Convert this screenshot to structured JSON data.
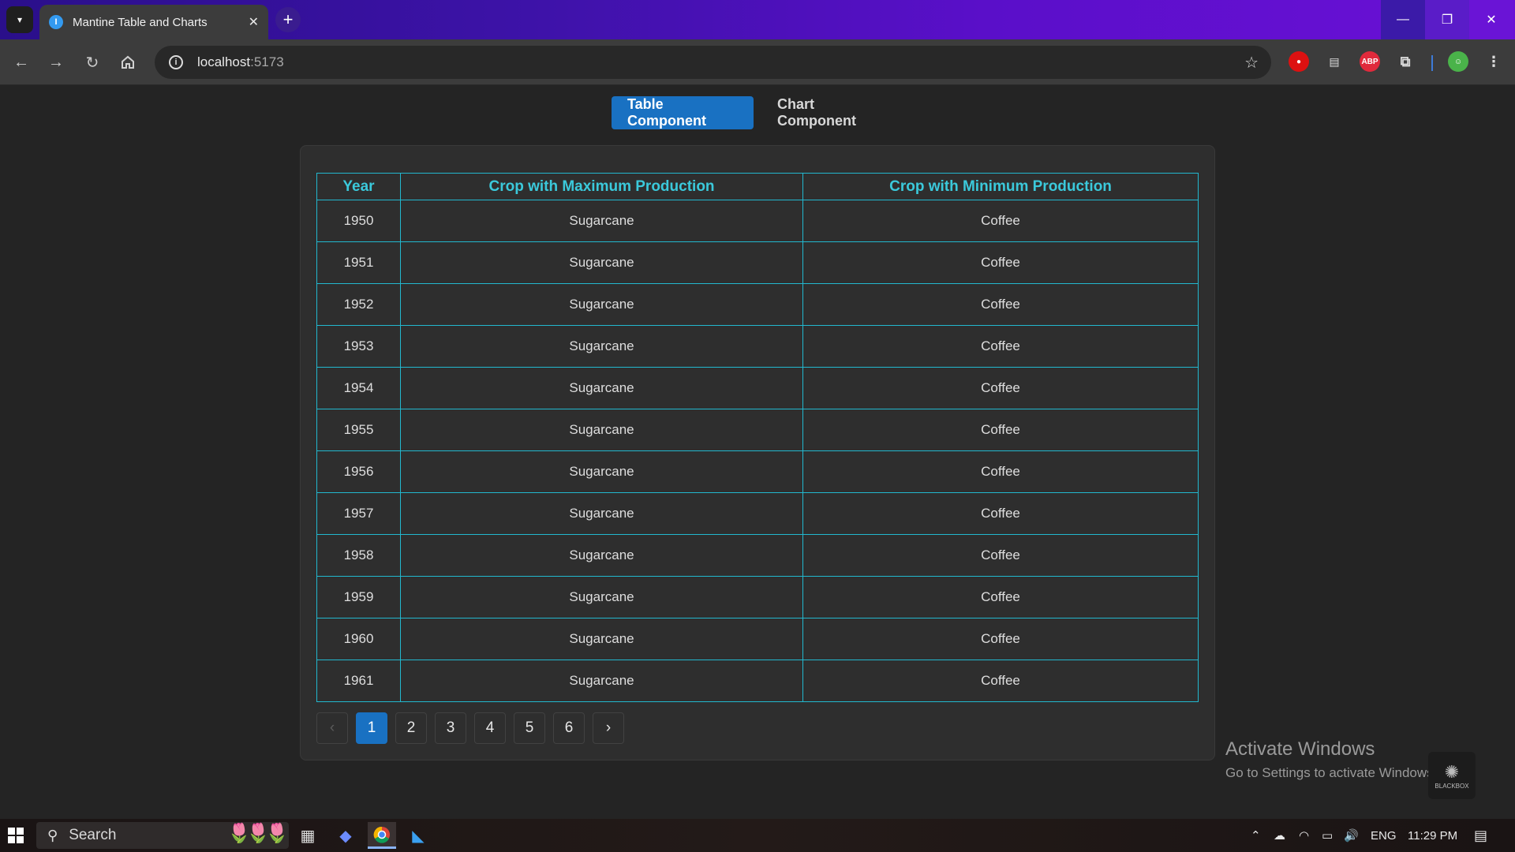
{
  "browser": {
    "tab_title": "Mantine Table and Charts",
    "tab_favicon_letter": "I",
    "url_host": "localhost",
    "url_port": ":5173"
  },
  "nav_tabs": {
    "table_label": "Table Component",
    "chart_label": "Chart Component"
  },
  "table": {
    "headers": [
      "Year",
      "Crop with Maximum Production",
      "Crop with Minimum Production"
    ],
    "rows": [
      [
        "1950",
        "Sugarcane",
        "Coffee"
      ],
      [
        "1951",
        "Sugarcane",
        "Coffee"
      ],
      [
        "1952",
        "Sugarcane",
        "Coffee"
      ],
      [
        "1953",
        "Sugarcane",
        "Coffee"
      ],
      [
        "1954",
        "Sugarcane",
        "Coffee"
      ],
      [
        "1955",
        "Sugarcane",
        "Coffee"
      ],
      [
        "1956",
        "Sugarcane",
        "Coffee"
      ],
      [
        "1957",
        "Sugarcane",
        "Coffee"
      ],
      [
        "1958",
        "Sugarcane",
        "Coffee"
      ],
      [
        "1959",
        "Sugarcane",
        "Coffee"
      ],
      [
        "1960",
        "Sugarcane",
        "Coffee"
      ],
      [
        "1961",
        "Sugarcane",
        "Coffee"
      ]
    ],
    "header_color": "#3bc9db",
    "border_color": "#22b8cf"
  },
  "pagination": {
    "prev": "‹",
    "next": "›",
    "pages": [
      "1",
      "2",
      "3",
      "4",
      "5",
      "6"
    ],
    "current": "1"
  },
  "watermark": {
    "line1": "Activate Windows",
    "line2": "Go to Settings to activate Windows.",
    "badge": "BLACKBOX"
  },
  "taskbar": {
    "search_label": "Search",
    "language": "ENG",
    "time": "11:29 PM"
  },
  "colors": {
    "accent": "#1971c2",
    "background": "#242424"
  }
}
